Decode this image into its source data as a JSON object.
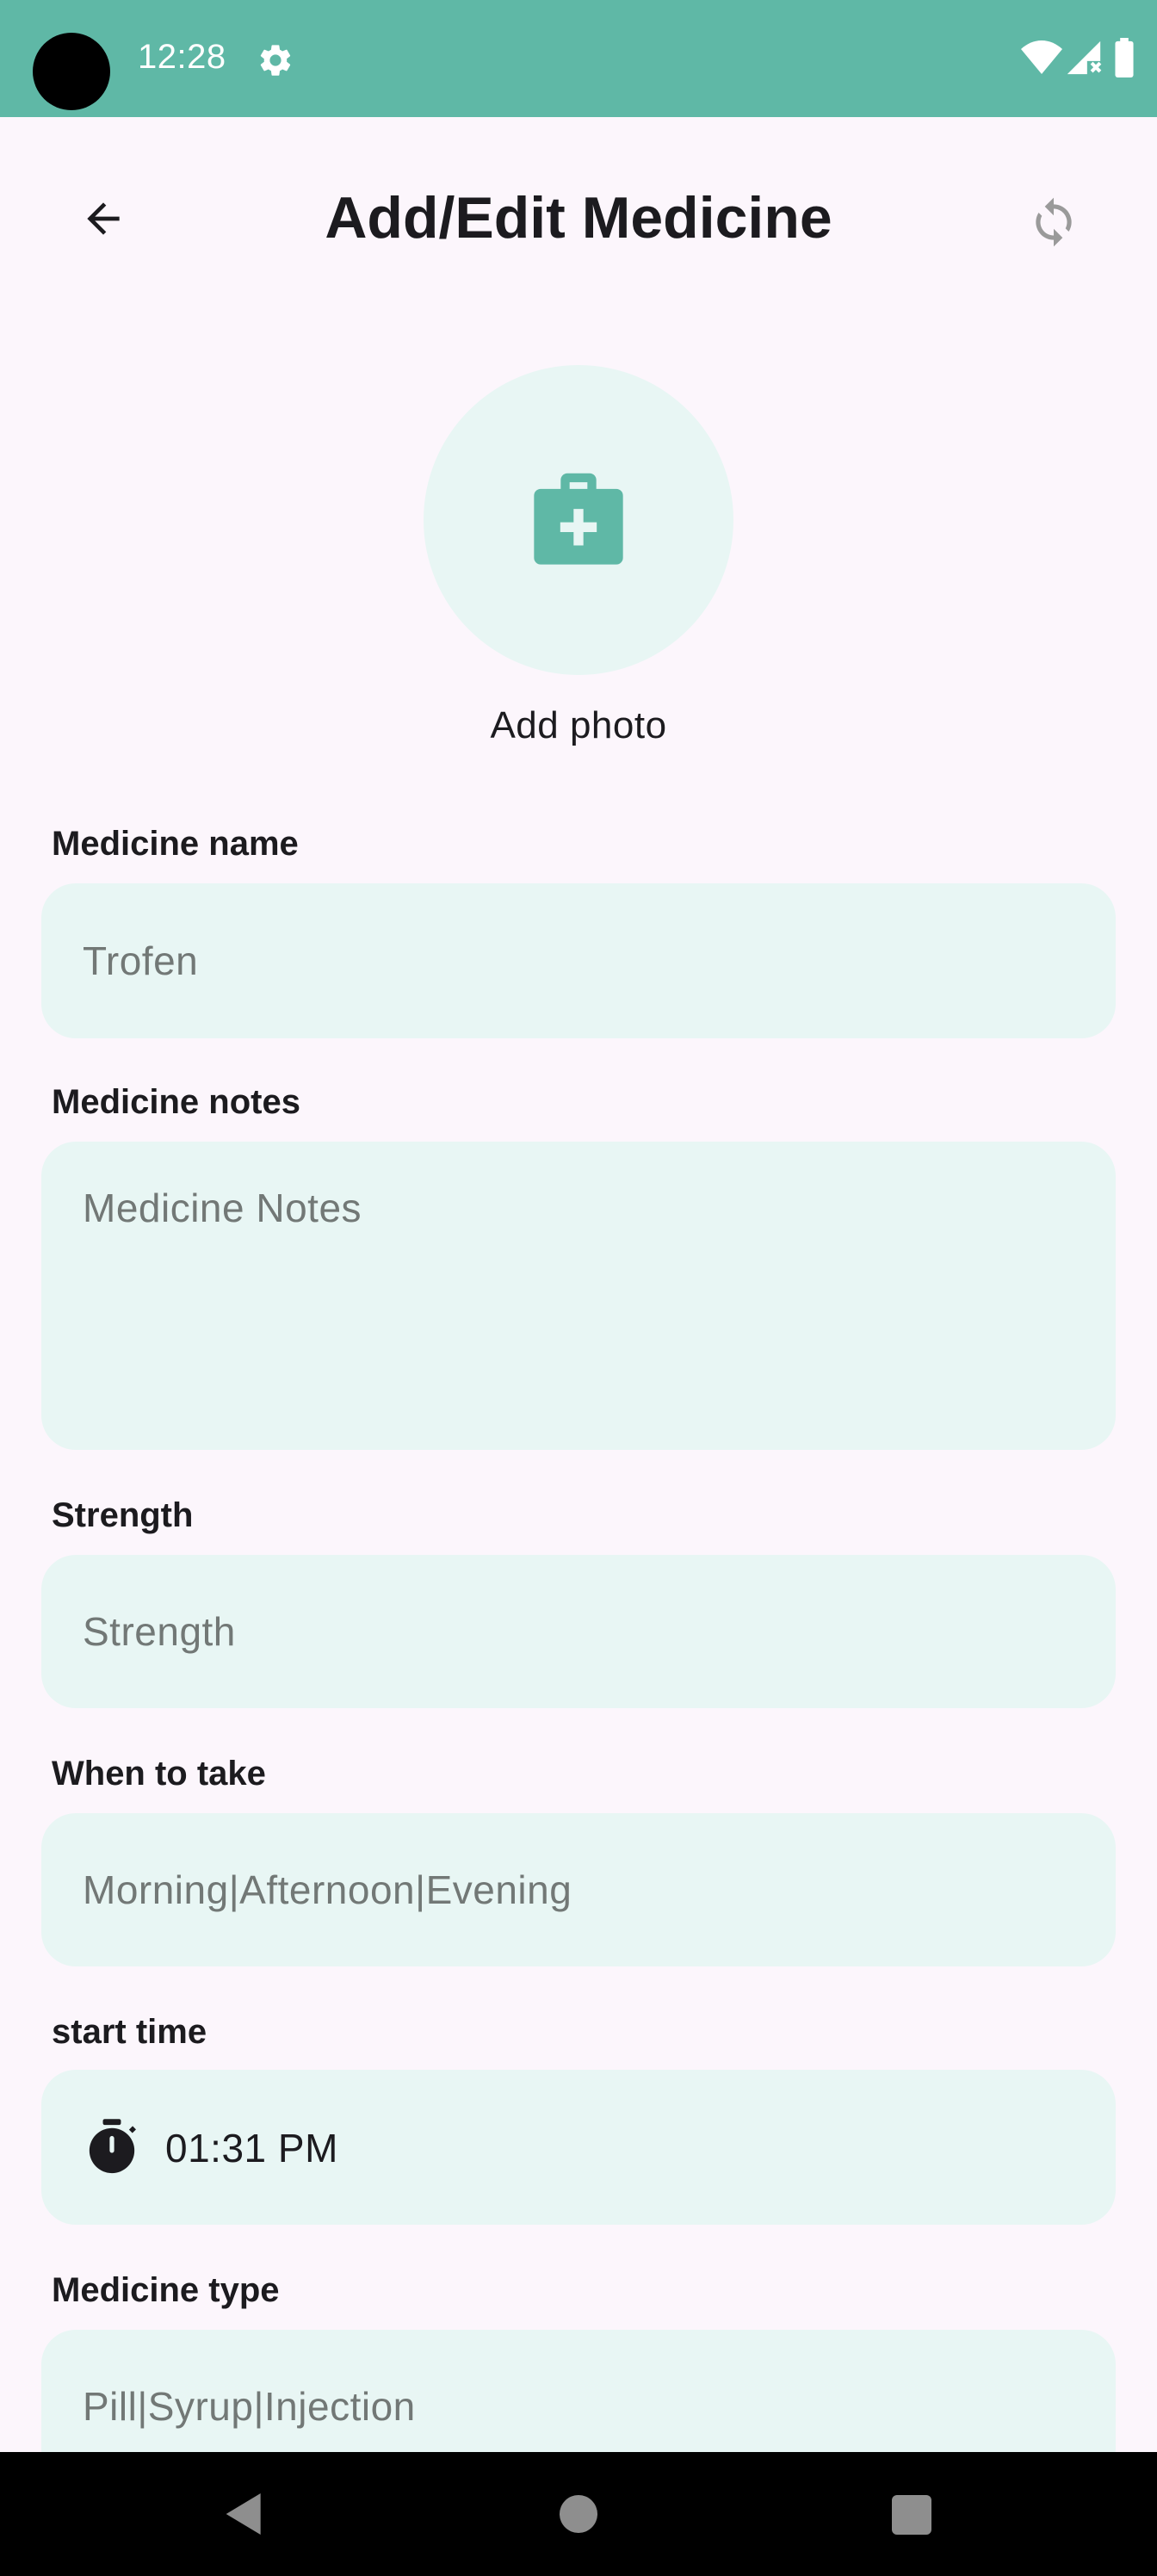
{
  "status_bar": {
    "time": "12:28",
    "icons": [
      "settings-icon",
      "wifi-icon",
      "signal-icon",
      "battery-icon"
    ]
  },
  "app_bar": {
    "title": "Add/Edit Medicine",
    "back_icon": "arrow-left-icon",
    "refresh_icon": "refresh-icon"
  },
  "photo": {
    "icon": "medical-kit-icon",
    "label": "Add photo"
  },
  "form": {
    "medicine_name": {
      "label": "Medicine name",
      "placeholder": "Trofen",
      "value": ""
    },
    "medicine_notes": {
      "label": "Medicine notes",
      "placeholder": "Medicine Notes",
      "value": ""
    },
    "strength": {
      "label": "Strength",
      "placeholder": "Strength",
      "value": ""
    },
    "when_to_take": {
      "label": "When to take",
      "placeholder": "Morning|Afternoon|Evening",
      "value": ""
    },
    "start_time": {
      "label": "start time",
      "value": "01:31 PM",
      "icon": "timer-icon"
    },
    "medicine_type": {
      "label": "Medicine type",
      "placeholder": "Pill|Syrup|Injection",
      "value": ""
    }
  },
  "colors": {
    "accent": "#5fb8a6",
    "field_background": "#e8f6f4",
    "page_background": "#fcf6fc",
    "text": "#1c1b1f",
    "placeholder": "#727876"
  },
  "nav_bar": {
    "icons": [
      "nav-back-icon",
      "nav-home-icon",
      "nav-recents-icon"
    ]
  }
}
